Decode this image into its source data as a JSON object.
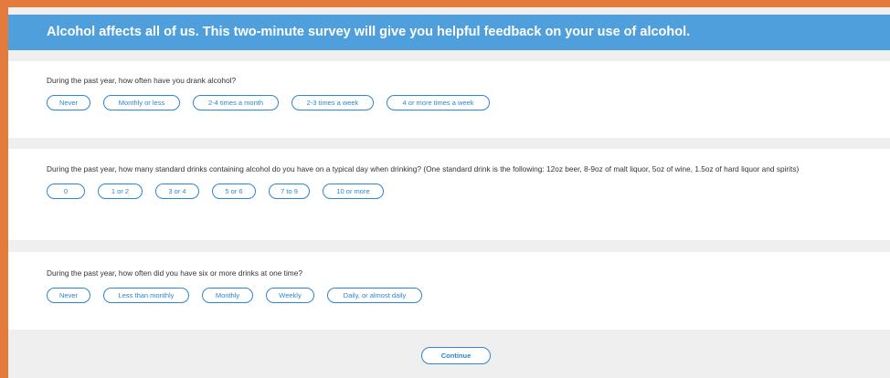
{
  "header": {
    "title": "Alcohol affects all of us. This two-minute survey will give you helpful feedback on your use of alcohol."
  },
  "questions": [
    {
      "text": "During the past year, how often have you drank alcohol?",
      "options": [
        "Never",
        "Monthly or less",
        "2-4 times a month",
        "2-3 times a week",
        "4 or more times a week"
      ]
    },
    {
      "text": "During the past year, how many standard drinks containing alcohol do you have on a typical day when drinking? (One standard drink is the following: 12oz beer, 8-9oz of malt liquor, 5oz of wine, 1.5oz of hard liquor and spirits)",
      "options": [
        "0",
        "1 or 2",
        "3 or 4",
        "5 or 6",
        "7 to 9",
        "10 or more"
      ]
    },
    {
      "text": "During the past year, how often did you have six or more drinks at one time?",
      "options": [
        "Never",
        "Less than monthly",
        "Monthly",
        "Weekly",
        "Daily, or almost daily"
      ]
    }
  ],
  "footer": {
    "continue_label": "Continue"
  },
  "colors": {
    "accent": "#2b86d4",
    "header_bg": "#4f9fdc",
    "outer_frame": "#e27b3c",
    "page_bg": "#efefef"
  }
}
